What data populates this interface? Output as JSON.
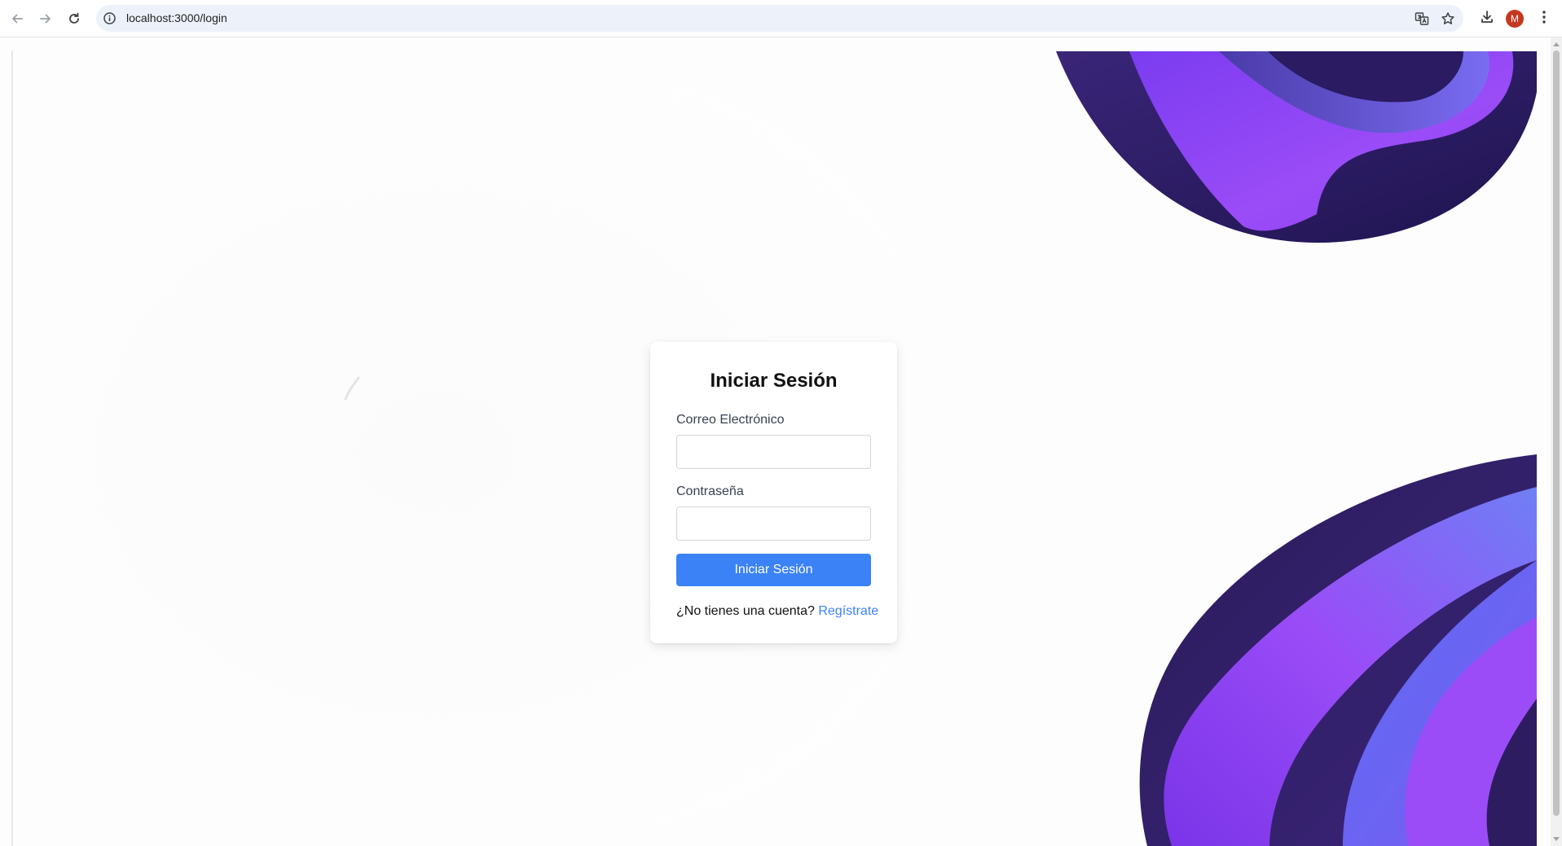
{
  "browser": {
    "url": "localhost:3000/login",
    "profile_initial": "M",
    "icons": {
      "back": "arrow-left-icon",
      "forward": "arrow-right-icon",
      "reload": "reload-icon",
      "site_info": "info-icon",
      "translate": "translate-icon",
      "bookmark": "star-icon",
      "downloads": "download-icon",
      "menu": "kebab-menu-icon"
    }
  },
  "login": {
    "title": "Iniciar Sesión",
    "email_label": "Correo Electrónico",
    "email_value": "",
    "password_label": "Contraseña",
    "password_value": "",
    "submit_label": "Iniciar Sesión",
    "signup_prompt": "¿No tienes una cuenta?",
    "signup_link": "Regístrate"
  },
  "colors": {
    "accent": "#3b82f6",
    "decor_dark": "#2e1d5e",
    "decor_purple": "#8b3df5",
    "decor_blue": "#6d5cf0"
  }
}
